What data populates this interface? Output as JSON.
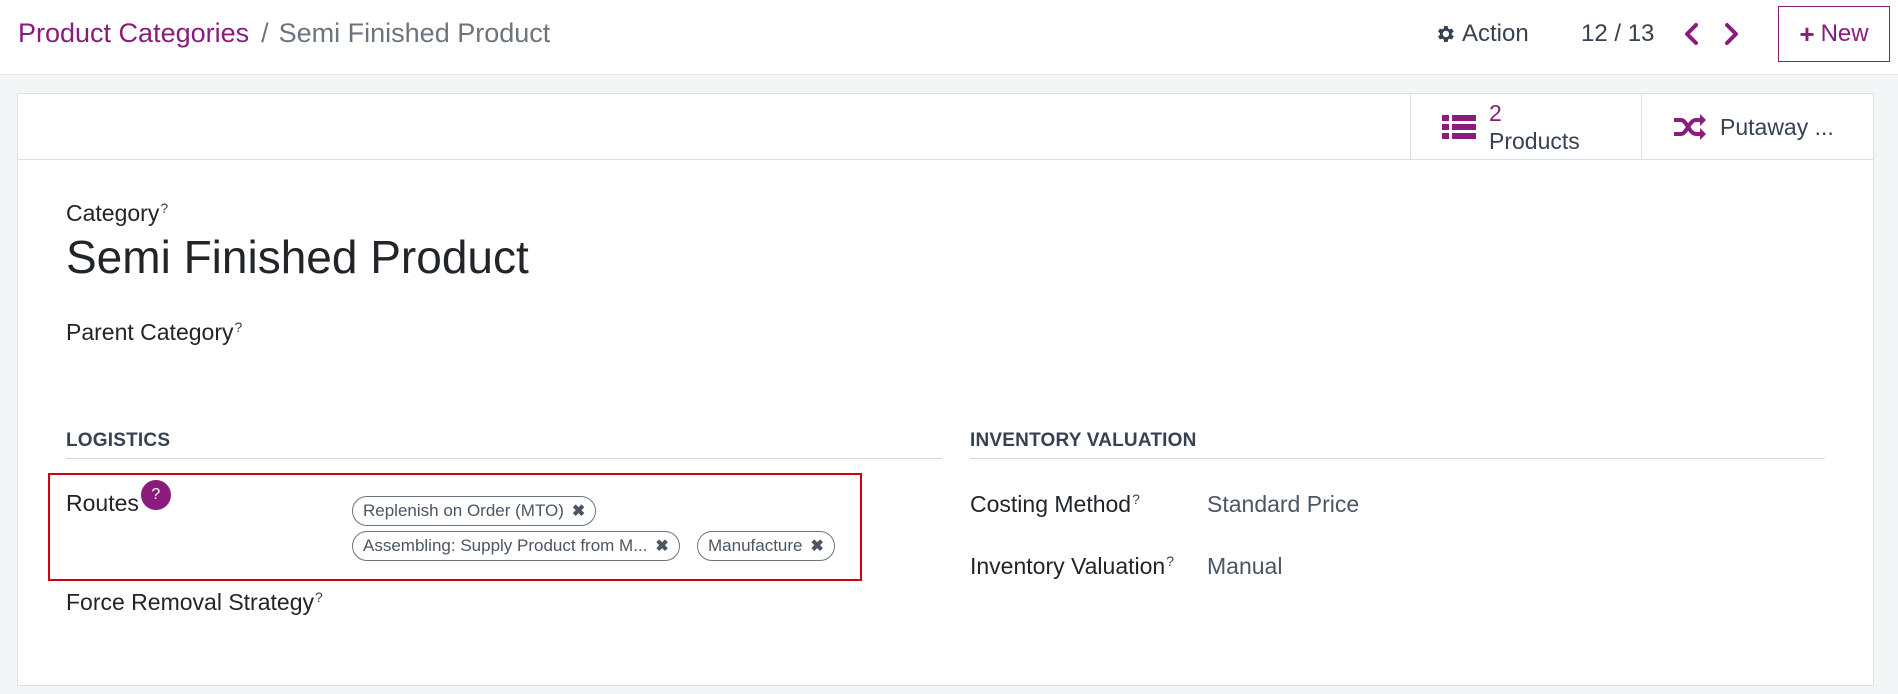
{
  "breadcrumb": {
    "parent": "Product Categories",
    "separator": "/",
    "current": "Semi Finished Product"
  },
  "toolbar": {
    "action_label": "Action",
    "pager": "12 / 13",
    "new_label": "New",
    "new_icon": "+"
  },
  "stat_buttons": {
    "products_count": "2",
    "products_label": "Products",
    "putaway_label": "Putaway ..."
  },
  "form": {
    "category_label": "Category",
    "category_value": "Semi Finished Product",
    "parent_category_label": "Parent Category",
    "help_marker": "?"
  },
  "logistics": {
    "section_title": "LOGISTICS",
    "routes_label": "Routes",
    "routes_help": "?",
    "routes_tags": [
      "Replenish on Order (MTO)",
      "Assembling: Supply Product from M...",
      "Manufacture"
    ],
    "tag_remove": "✖",
    "force_removal_label": "Force Removal Strategy"
  },
  "inventory_valuation": {
    "section_title": "INVENTORY VALUATION",
    "costing_method_label": "Costing Method",
    "costing_method_value": "Standard Price",
    "valuation_label": "Inventory Valuation",
    "valuation_value": "Manual"
  },
  "colors": {
    "accent": "#8a1c7c",
    "highlight_border": "#d0000e"
  }
}
